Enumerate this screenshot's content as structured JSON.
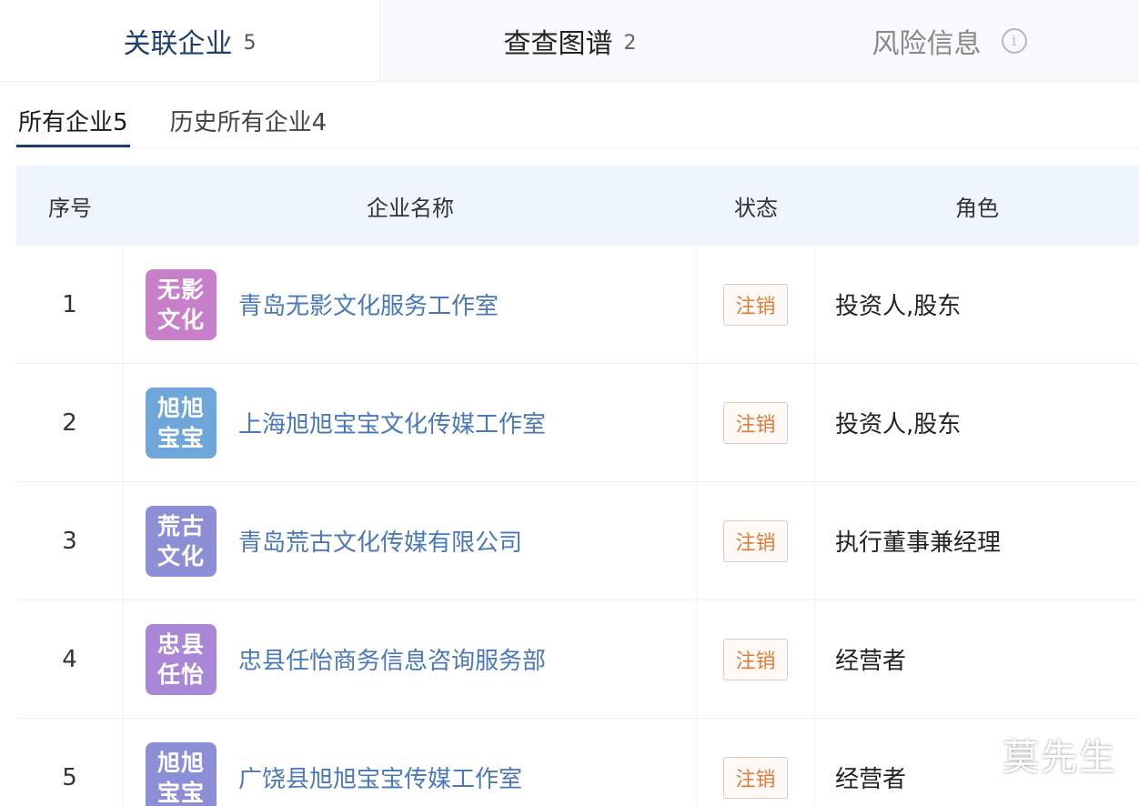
{
  "top_tabs": [
    {
      "label": "关联企业",
      "count": "5"
    },
    {
      "label": "查查图谱",
      "count": "2"
    },
    {
      "label": "风险信息",
      "info_icon": "i"
    }
  ],
  "sub_tabs": [
    {
      "label": "所有企业",
      "count": "5"
    },
    {
      "label": "历史所有企业",
      "count": "4"
    }
  ],
  "table": {
    "headers": {
      "index": "序号",
      "name": "企业名称",
      "status": "状态",
      "role": "角色"
    },
    "rows": [
      {
        "index": "1",
        "logo_line1": "无影",
        "logo_line2": "文化",
        "logo_color": "#c77fc9",
        "name": "青岛无影文化服务工作室",
        "status": "注销",
        "role": "投资人,股东"
      },
      {
        "index": "2",
        "logo_line1": "旭旭",
        "logo_line2": "宝宝",
        "logo_color": "#6fa6d9",
        "name": "上海旭旭宝宝文化传媒工作室",
        "status": "注销",
        "role": "投资人,股东"
      },
      {
        "index": "3",
        "logo_line1": "荒古",
        "logo_line2": "文化",
        "logo_color": "#8d8fd6",
        "name": "青岛荒古文化传媒有限公司",
        "status": "注销",
        "role": "执行董事兼经理"
      },
      {
        "index": "4",
        "logo_line1": "忠县",
        "logo_line2": "任怡",
        "logo_color": "#a987d6",
        "name": "忠县任怡商务信息咨询服务部",
        "status": "注销",
        "role": "经营者"
      },
      {
        "index": "5",
        "logo_line1": "旭旭",
        "logo_line2": "宝宝",
        "logo_color": "#8d8fd6",
        "name": "广饶县旭旭宝宝传媒工作室",
        "status": "注销",
        "role": "经营者"
      }
    ]
  },
  "watermark": "莫先生",
  "colors": {
    "accent": "#1d3b6e",
    "link": "#4a78b8",
    "status_text": "#e07b39",
    "header_bg": "#eef4fb"
  }
}
